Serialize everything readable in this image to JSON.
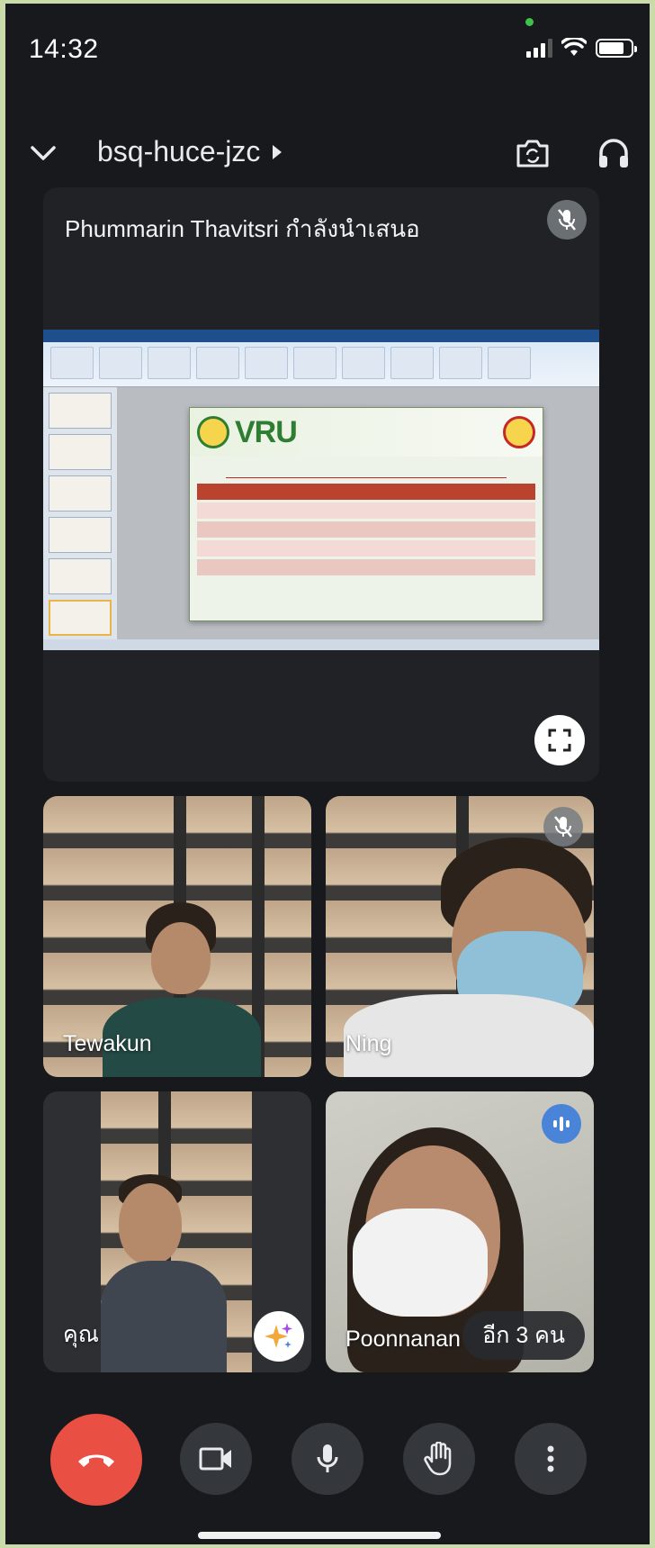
{
  "status_bar": {
    "time": "14:32",
    "icons": [
      "signal-icon",
      "wifi-icon",
      "battery-icon"
    ]
  },
  "header": {
    "meeting_code": "bsq-huce-jzc",
    "icons": [
      "chevron-down-icon",
      "switch-camera-icon",
      "headphones-icon"
    ]
  },
  "presenter": {
    "label": "Phummarin Thavitsri กำลังนำเสนอ",
    "slide_logo": "VRU",
    "muted": true
  },
  "participants": [
    {
      "name": "Tewakun",
      "muted": false
    },
    {
      "name": "Ning",
      "muted": true
    },
    {
      "name": "คุณ",
      "muted": false
    },
    {
      "name": "Poonnanan",
      "speaking": true
    }
  ],
  "more_participants": "อีก 3 คน",
  "controls": {
    "icons": [
      "end-call-icon",
      "camera-icon",
      "microphone-icon",
      "raise-hand-icon",
      "more-options-icon"
    ]
  },
  "colors": {
    "background": "#17191c",
    "tile": "#2d2f33",
    "end_call": "#ea4f43",
    "speaking": "#4a84d8",
    "frame": "#c8dba8"
  }
}
